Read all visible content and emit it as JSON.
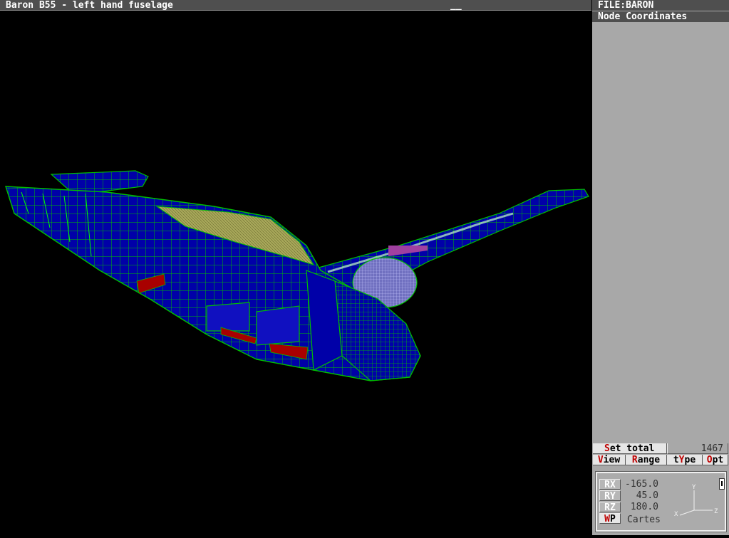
{
  "title_bar": {
    "title": "Baron B55 - left hand fuselage",
    "cursor": "__"
  },
  "panel": {
    "file_label": "FILE:BARON",
    "mode_label": "Node Coordinates",
    "set_total": {
      "label_hot": "S",
      "label_rest": "et total",
      "value": "1467"
    },
    "menu": [
      {
        "hot": "V",
        "rest": "iew"
      },
      {
        "hot": "R",
        "rest": "ange"
      },
      {
        "pre": "t",
        "hot": "Y",
        "rest": "pe"
      },
      {
        "hot": "O",
        "rest": "pt"
      }
    ],
    "rotation": {
      "rx": {
        "label": "RX",
        "value": "-165.0"
      },
      "ry": {
        "label": "RY",
        "value": "45.0"
      },
      "rz": {
        "label": "RZ",
        "value": "180.0"
      },
      "wp": {
        "hot": "W",
        "rest": "P",
        "mode": "Cartes"
      },
      "axes": {
        "y": "Y",
        "x": "X",
        "z": "Z"
      }
    }
  },
  "colors": {
    "panel_bg": "#a8a8a8",
    "title_bg": "#4f4f4f",
    "mesh_fill": "#0000a8",
    "mesh_edge": "#00c000",
    "highlight_red": "#a80000",
    "tan_region": "#a8a85a",
    "viewport_bg": "#000000"
  }
}
